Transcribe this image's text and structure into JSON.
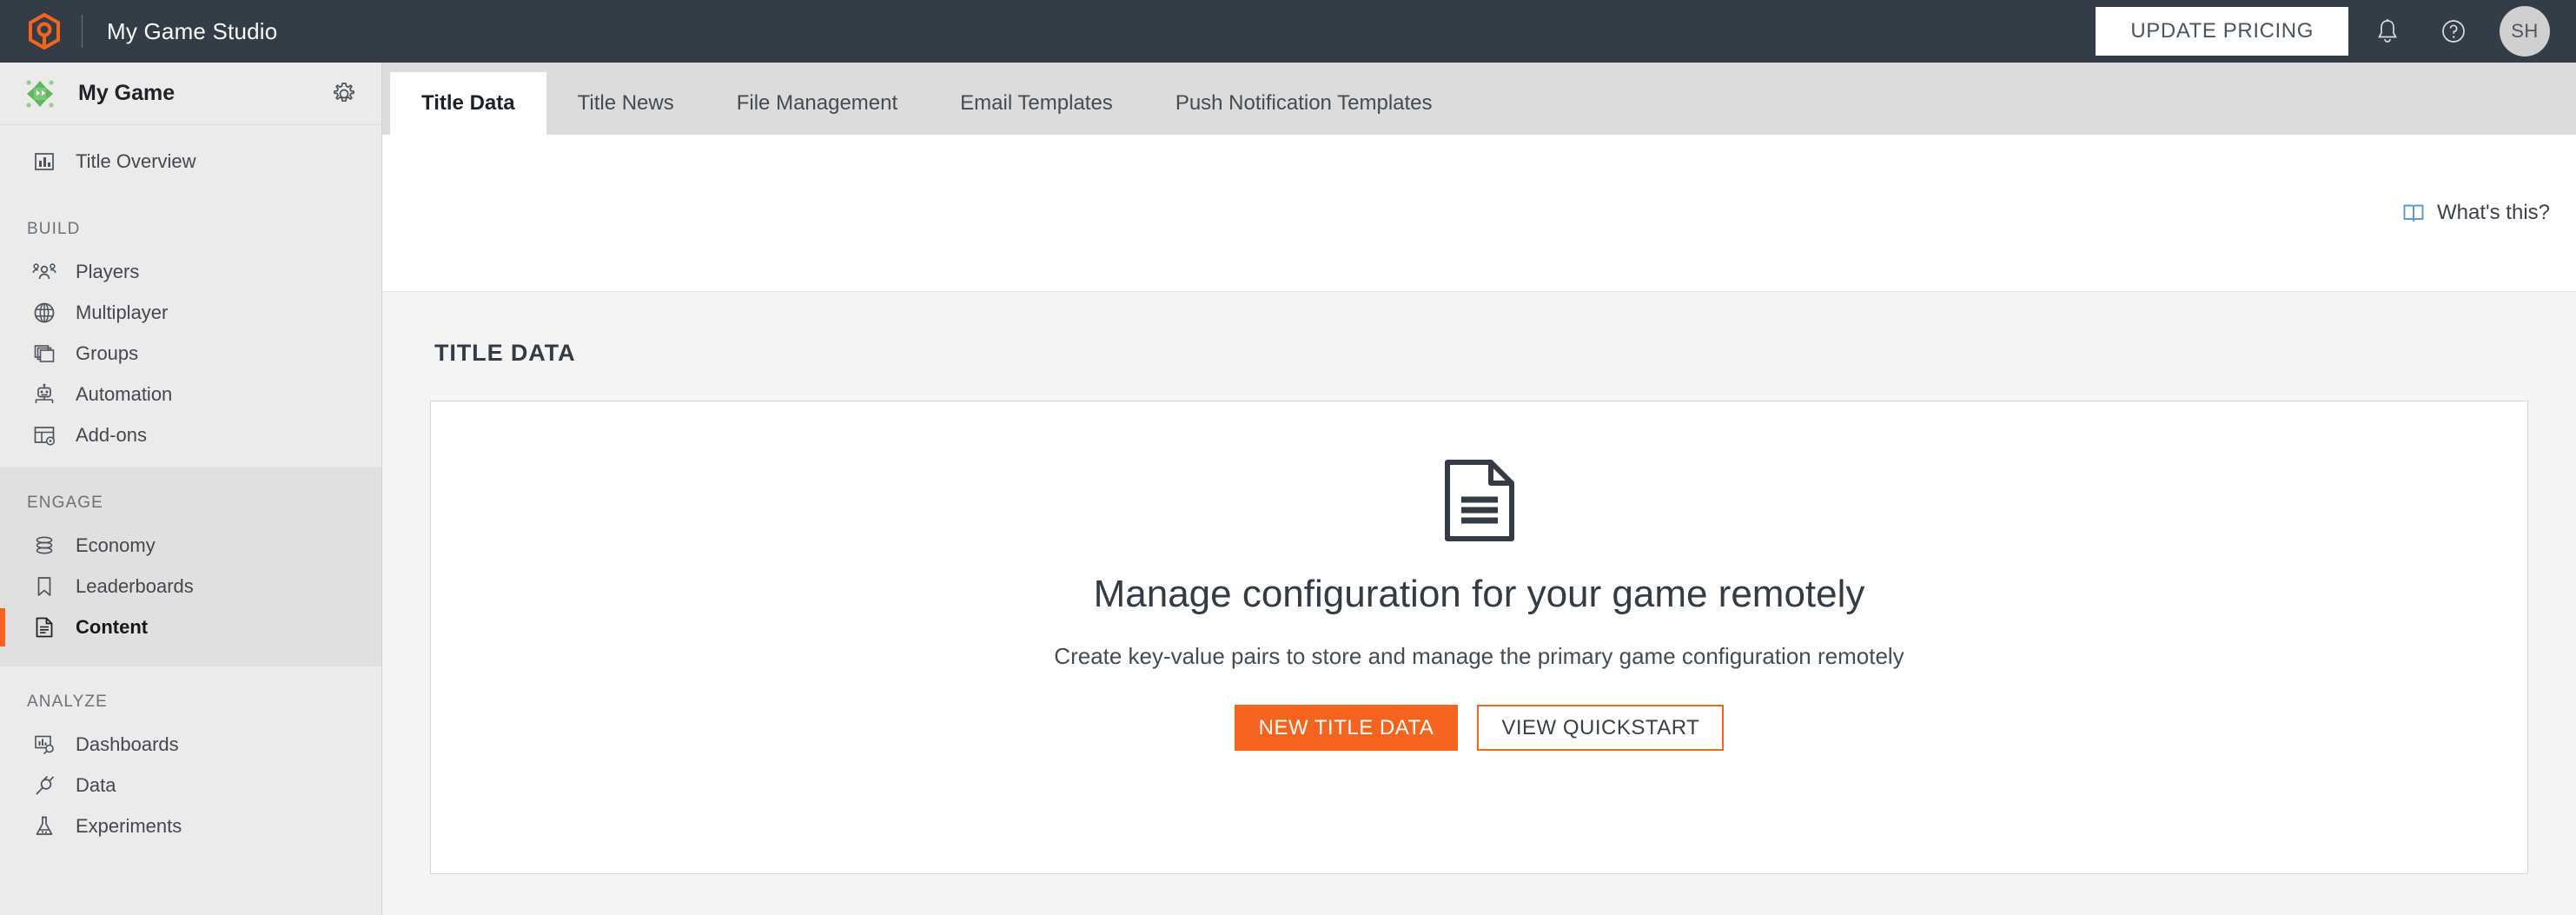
{
  "topbar": {
    "studio_name": "My Game Studio",
    "update_pricing_label": "UPDATE PRICING",
    "notifications_icon": "bell-icon",
    "help_icon": "question-circle-icon",
    "avatar_initials": "SH",
    "background_color": "#333d47",
    "logo_color": "#f4641e"
  },
  "sidebar": {
    "game_name": "My Game",
    "settings_icon": "gear-icon",
    "overview": {
      "label": "Title Overview",
      "icon": "bar-chart-icon"
    },
    "sections": [
      {
        "label": "BUILD",
        "items": [
          {
            "label": "Players",
            "icon": "people-icon"
          },
          {
            "label": "Multiplayer",
            "icon": "globe-icon"
          },
          {
            "label": "Groups",
            "icon": "windows-stack-icon"
          },
          {
            "label": "Automation",
            "icon": "robot-icon"
          },
          {
            "label": "Add-ons",
            "icon": "table-gear-icon"
          }
        ]
      },
      {
        "label": "ENGAGE",
        "items": [
          {
            "label": "Economy",
            "icon": "database-icon"
          },
          {
            "label": "Leaderboards",
            "icon": "bookmark-icon"
          },
          {
            "label": "Content",
            "icon": "document-icon",
            "active": true
          }
        ]
      },
      {
        "label": "ANALYZE",
        "items": [
          {
            "label": "Dashboards",
            "icon": "chart-search-icon"
          },
          {
            "label": "Data",
            "icon": "plug-icon"
          },
          {
            "label": "Experiments",
            "icon": "flask-icon"
          }
        ]
      }
    ],
    "active_indicator_color": "#f4641e"
  },
  "main": {
    "tabs": [
      {
        "label": "Title Data",
        "active": true
      },
      {
        "label": "Title News",
        "active": false
      },
      {
        "label": "File Management",
        "active": false
      },
      {
        "label": "Email Templates",
        "active": false
      },
      {
        "label": "Push Notification Templates",
        "active": false
      }
    ],
    "whats_this": {
      "label": "What's this?",
      "icon": "book-icon",
      "icon_color": "#5b9bd5"
    },
    "page_title": "TITLE DATA",
    "empty_state": {
      "icon": "document-icon",
      "headline": "Manage configuration for your game remotely",
      "subtext": "Create key-value pairs to store and manage the primary game configuration remotely",
      "primary_button": "NEW TITLE DATA",
      "secondary_button": "VIEW QUICKSTART"
    },
    "accent_color": "#f4641e"
  }
}
